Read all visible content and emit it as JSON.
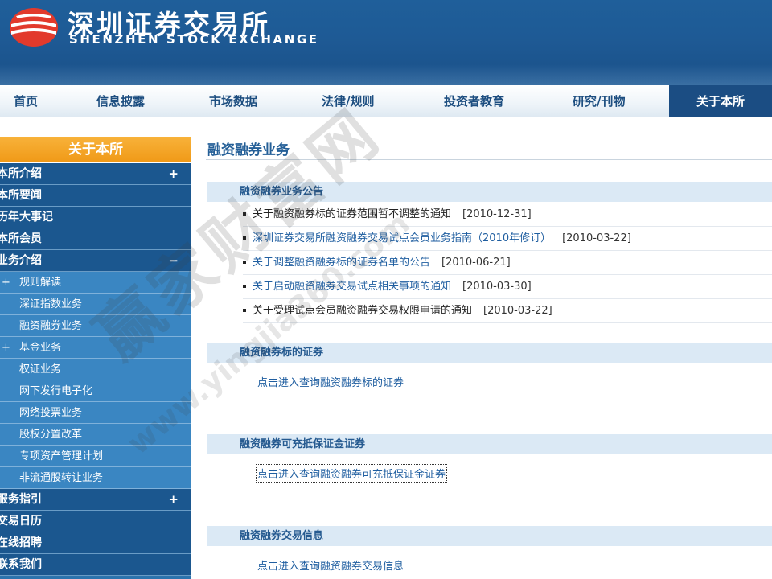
{
  "header": {
    "logo_cn": "深圳证券交易所",
    "logo_en": "SHENZHEN STOCK EXCHANGE",
    "logo_icon": "szse-logo-icon"
  },
  "nav": [
    {
      "label": "首页"
    },
    {
      "label": "信息披露"
    },
    {
      "label": "市场数据"
    },
    {
      "label": "法律/规则"
    },
    {
      "label": "投资者教育"
    },
    {
      "label": "研究/刊物"
    },
    {
      "label": "关于本所",
      "active": true
    }
  ],
  "sidebar": {
    "title": "关于本所",
    "main_items": [
      {
        "label": "本所介绍",
        "sign": "+"
      },
      {
        "label": "本所要闻",
        "sign": ""
      },
      {
        "label": "历年大事记",
        "sign": ""
      },
      {
        "label": "本所会员",
        "sign": ""
      },
      {
        "label": "业务介绍",
        "sign": "−"
      }
    ],
    "sub_items": [
      {
        "label": "规则解读",
        "sign": "+"
      },
      {
        "label": "深证指数业务",
        "sign": ""
      },
      {
        "label": "融资融券业务",
        "sign": ""
      },
      {
        "label": "基金业务",
        "sign": "+"
      },
      {
        "label": "权证业务",
        "sign": ""
      },
      {
        "label": "网下发行电子化",
        "sign": ""
      },
      {
        "label": "网络投票业务",
        "sign": ""
      },
      {
        "label": "股权分置改革",
        "sign": ""
      },
      {
        "label": "专项资产管理计划",
        "sign": ""
      },
      {
        "label": "非流通股转让业务",
        "sign": ""
      }
    ],
    "bottom_items": [
      {
        "label": "服务指引",
        "sign": "+"
      },
      {
        "label": "交易日历",
        "sign": ""
      },
      {
        "label": "在线招聘",
        "sign": ""
      },
      {
        "label": "联系我们",
        "sign": ""
      }
    ]
  },
  "main": {
    "title": "融资融券业务",
    "sections": [
      {
        "heading": "融资融券业务公告"
      },
      {
        "heading": "融资融券标的证券",
        "link": "点击进入查询融资融券标的证券"
      },
      {
        "heading": "融资融券可充抵保证金证券",
        "link": "点击进入查询融资融券可充抵保证金证券"
      },
      {
        "heading": "融资融券交易信息",
        "link": "点击进入查询融资融券交易信息"
      }
    ],
    "notices": [
      {
        "title": "关于融资融券标的证券范围暂不调整的通知",
        "date": "[2010-12-31]",
        "link": false
      },
      {
        "title": "深圳证券交易所融资融券交易试点会员业务指南（2010年修订）",
        "date": "[2010-03-22]",
        "link": true
      },
      {
        "title": "关于调整融资融券标的证券名单的公告",
        "date": "[2010-06-21]",
        "link": true
      },
      {
        "title": "关于启动融资融券交易试点相关事项的通知",
        "date": "[2010-03-30]",
        "link": true
      },
      {
        "title": "关于受理试点会员融资融券交易权限申请的通知",
        "date": "[2010-03-22]",
        "link": false
      }
    ]
  },
  "watermark": {
    "text": "赢家财富网",
    "url": "www.yingjia360.com"
  },
  "colors": {
    "header_blue": "#1e5a95",
    "nav_active": "#1b4d83",
    "sidebar_title_orange": "#f09a18",
    "sidebar_main": "#1b578f",
    "sidebar_sub": "#3a86c2",
    "section_head_bg": "#dbe9f5",
    "link_blue": "#1f5ea0"
  }
}
